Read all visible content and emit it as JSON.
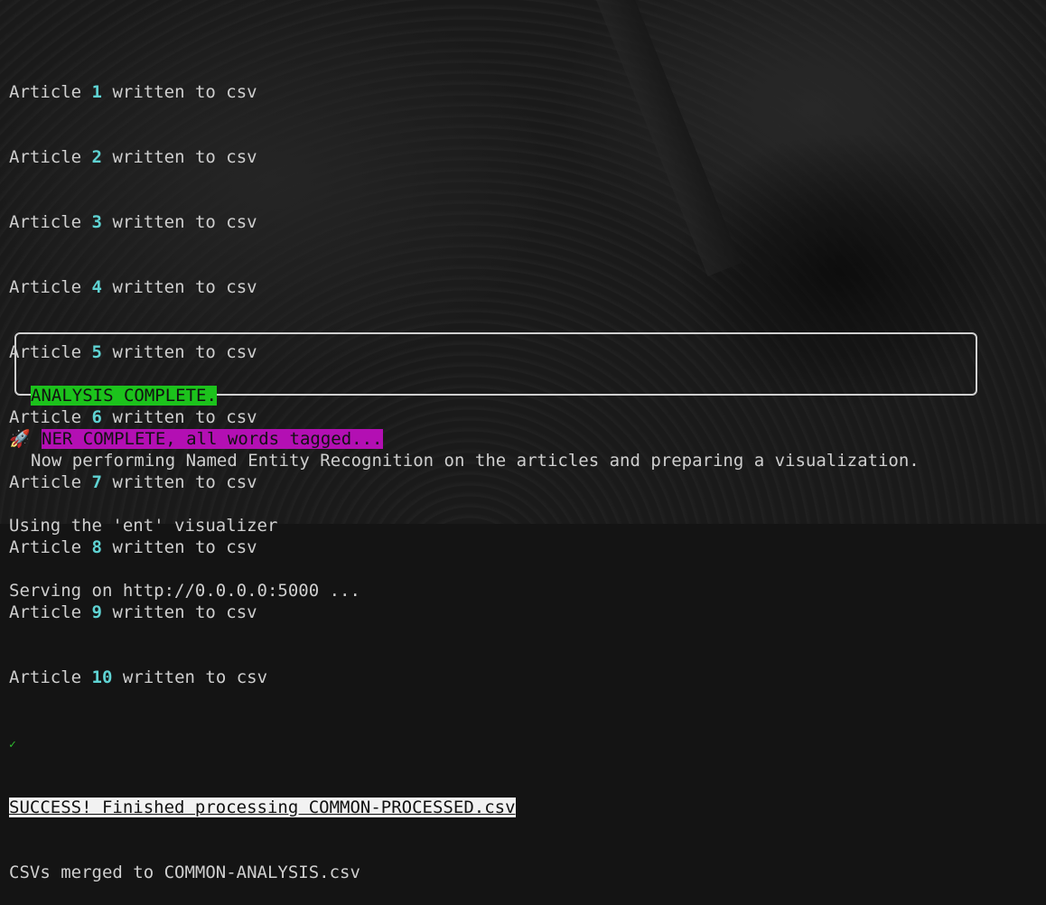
{
  "articles": [
    {
      "prefix": "Article",
      "number": "1",
      "suffix": "written to csv"
    },
    {
      "prefix": "Article",
      "number": "2",
      "suffix": "written to csv"
    },
    {
      "prefix": "Article",
      "number": "3",
      "suffix": "written to csv"
    },
    {
      "prefix": "Article",
      "number": "4",
      "suffix": "written to csv"
    },
    {
      "prefix": "Article",
      "number": "5",
      "suffix": "written to csv"
    },
    {
      "prefix": "Article",
      "number": "6",
      "suffix": "written to csv"
    },
    {
      "prefix": "Article",
      "number": "7",
      "suffix": "written to csv"
    },
    {
      "prefix": "Article",
      "number": "8",
      "suffix": "written to csv"
    },
    {
      "prefix": "Article",
      "number": "9",
      "suffix": "written to csv"
    },
    {
      "prefix": "Article",
      "number": "10",
      "suffix": "written to csv"
    }
  ],
  "checkmark": "✓",
  "success_text": "SUCCESS! Finished processing COMMON-PROCESSED.csv",
  "merged_text": "CSVs merged to COMMON-ANALYSIS.csv",
  "analysis_box": {
    "title": "ANALYSIS COMPLETE.",
    "body": "Now performing Named Entity Recognition on the articles and preparing a visualization."
  },
  "ner_icon": "🚀",
  "ner_text": "NER COMPLETE, all words tagged...",
  "visualizer_text": "Using the 'ent' visualizer",
  "serving_text": "Serving on http://0.0.0.0:5000 ...",
  "colors": {
    "number": "#5fd3d3",
    "success_bg": "#f2f2f2",
    "complete_bg": "#1cc21c",
    "ner_bg": "#b30fb3",
    "check": "#2fbf2f"
  }
}
